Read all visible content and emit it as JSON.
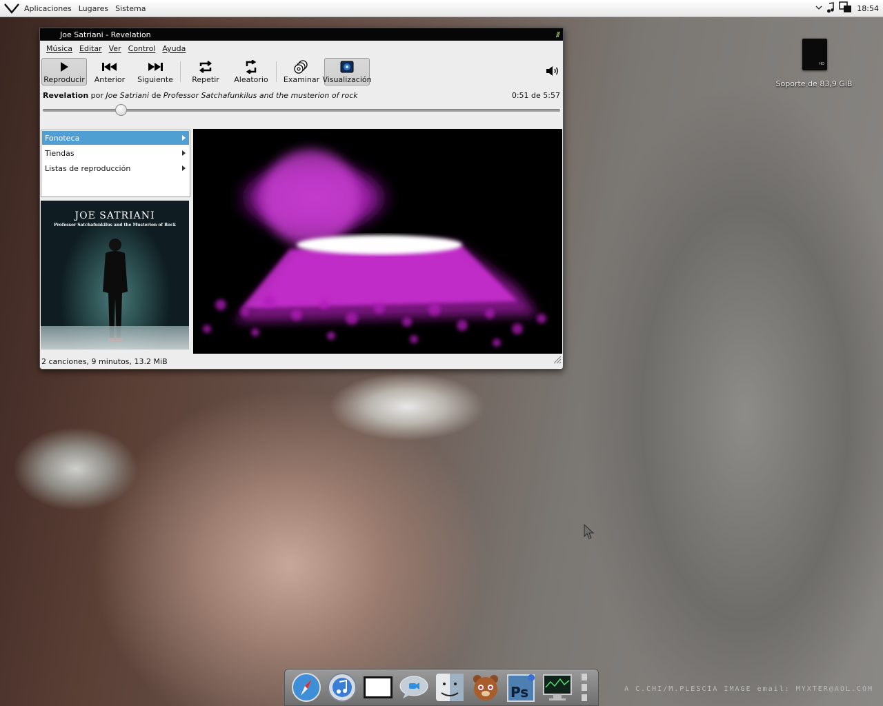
{
  "top_panel": {
    "menus": [
      "Aplicaciones",
      "Lugares",
      "Sistema"
    ],
    "clock": "18:54",
    "tray_icons": [
      "eject-icon",
      "music-note-icon",
      "network-icon"
    ]
  },
  "desktop": {
    "drive_label": "Soporte de 83,9 GiB",
    "drive_badge": "HD",
    "watermark": "A C.CHI/M.PLESCIA IMAGE email: MYXTER@AOL.COM"
  },
  "window": {
    "title": "Joe Satriani - Revelation",
    "menus": [
      "Música",
      "Editar",
      "Ver",
      "Control",
      "Ayuda"
    ],
    "toolbar": {
      "play": "Reproducir",
      "previous": "Anterior",
      "next": "Siguiente",
      "repeat": "Repetir",
      "shuffle": "Aleatorio",
      "browse": "Examinar",
      "visualization": "Visualización"
    },
    "song": {
      "title": "Revelation",
      "by": "por",
      "artist": "Joe Satriani",
      "from": "de",
      "album": "Professor Satchafunkilus and the musterion of rock",
      "time": "0:51 de 5:57",
      "progress_fraction": 0.143
    },
    "sidebar": {
      "items": [
        {
          "label": "Fonoteca",
          "selected": true
        },
        {
          "label": "Tiendas",
          "selected": false
        },
        {
          "label": "Listas de reproducción",
          "selected": false
        }
      ]
    },
    "cover": {
      "artist": "JOE SATRIANI",
      "album": "Professor Satchafunkilus and the Musterion of Rock"
    },
    "status": "2 canciones, 9 minutos, 13.2 MiB"
  },
  "dock": {
    "icons": [
      "safari-icon",
      "itunes-icon",
      "terminal-window-icon",
      "chat-bubble-icon",
      "finder-icon",
      "bear-icon",
      "photoshop-icon",
      "system-monitor-icon",
      "trash-icon"
    ]
  },
  "colors": {
    "selection": "#4f9fd2",
    "titlebar": "#060606",
    "viz_magenta": "#d62fe0"
  }
}
